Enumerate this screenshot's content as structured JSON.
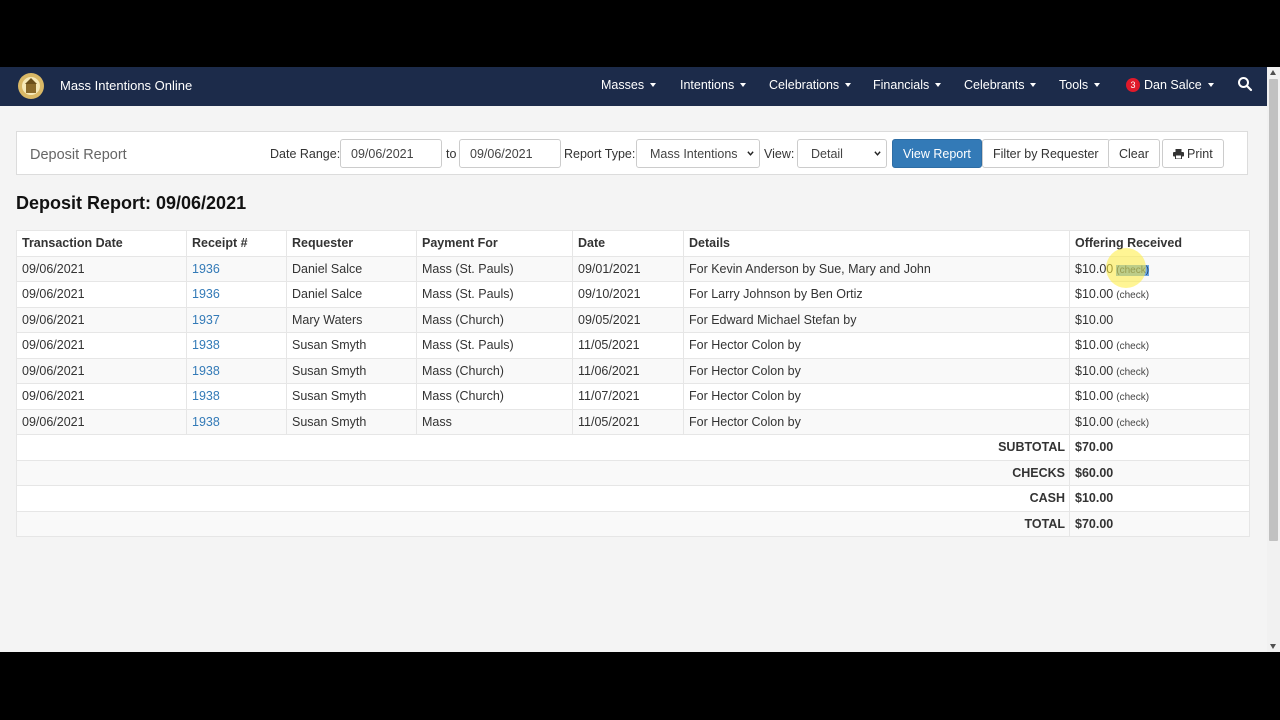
{
  "brand": {
    "title": "Mass Intentions Online"
  },
  "nav": {
    "items": [
      "Masses",
      "Intentions",
      "Celebrations",
      "Financials",
      "Celebrants",
      "Tools"
    ],
    "user": {
      "badge": "3",
      "name": "Dan Salce"
    }
  },
  "filter": {
    "title": "Deposit Report",
    "date_range_label": "Date Range:",
    "from_date": "09/06/2021",
    "to_label": "to",
    "to_date": "09/06/2021",
    "report_type_label": "Report Type:",
    "report_type_value": "Mass Intentions",
    "view_label": "View:",
    "view_value": "Detail",
    "view_report_label": "View Report",
    "filter_requester_label": "Filter by Requester",
    "clear_label": "Clear",
    "print_label": "Print"
  },
  "report": {
    "heading": "Deposit Report: 09/06/2021",
    "columns": [
      "Transaction Date",
      "Receipt #",
      "Requester",
      "Payment For",
      "Date",
      "Details",
      "Offering Received"
    ],
    "rows": [
      {
        "transaction_date": "09/06/2021",
        "receipt": "1936",
        "requester": "Daniel Salce",
        "payment_for": "Mass (St. Pauls)",
        "date": "09/01/2021",
        "details": "For Kevin Anderson by Sue, Mary and John",
        "amount": "$10.00",
        "payment_type": "(check)"
      },
      {
        "transaction_date": "09/06/2021",
        "receipt": "1936",
        "requester": "Daniel Salce",
        "payment_for": "Mass (St. Pauls)",
        "date": "09/10/2021",
        "details": "For Larry Johnson by Ben Ortiz",
        "amount": "$10.00",
        "payment_type": "(check)"
      },
      {
        "transaction_date": "09/06/2021",
        "receipt": "1937",
        "requester": "Mary Waters",
        "payment_for": "Mass (Church)",
        "date": "09/05/2021",
        "details": "For Edward Michael Stefan by",
        "amount": "$10.00",
        "payment_type": ""
      },
      {
        "transaction_date": "09/06/2021",
        "receipt": "1938",
        "requester": "Susan Smyth",
        "payment_for": "Mass (St. Pauls)",
        "date": "11/05/2021",
        "details": "For Hector Colon by",
        "amount": "$10.00",
        "payment_type": "(check)"
      },
      {
        "transaction_date": "09/06/2021",
        "receipt": "1938",
        "requester": "Susan Smyth",
        "payment_for": "Mass (Church)",
        "date": "11/06/2021",
        "details": "For Hector Colon by",
        "amount": "$10.00",
        "payment_type": "(check)"
      },
      {
        "transaction_date": "09/06/2021",
        "receipt": "1938",
        "requester": "Susan Smyth",
        "payment_for": "Mass (Church)",
        "date": "11/07/2021",
        "details": "For Hector Colon by",
        "amount": "$10.00",
        "payment_type": "(check)"
      },
      {
        "transaction_date": "09/06/2021",
        "receipt": "1938",
        "requester": "Susan Smyth",
        "payment_for": "Mass",
        "date": "11/05/2021",
        "details": "For Hector Colon by",
        "amount": "$10.00",
        "payment_type": "(check)"
      }
    ],
    "summary": [
      {
        "label": "SUBTOTAL",
        "value": "$70.00"
      },
      {
        "label": "CHECKS",
        "value": "$60.00"
      },
      {
        "label": "CASH",
        "value": "$10.00"
      },
      {
        "label": "TOTAL",
        "value": "$70.00"
      }
    ]
  },
  "colors": {
    "navbar": "#1c2b4a",
    "primary_button": "#337ab7",
    "link": "#337ab7",
    "badge": "#e0192a",
    "page_background": "#f4f4f4"
  },
  "icons": {
    "logo": "church-logo-icon",
    "search": "search-icon",
    "print": "printer-icon",
    "dropdown": "caret-down-icon"
  }
}
